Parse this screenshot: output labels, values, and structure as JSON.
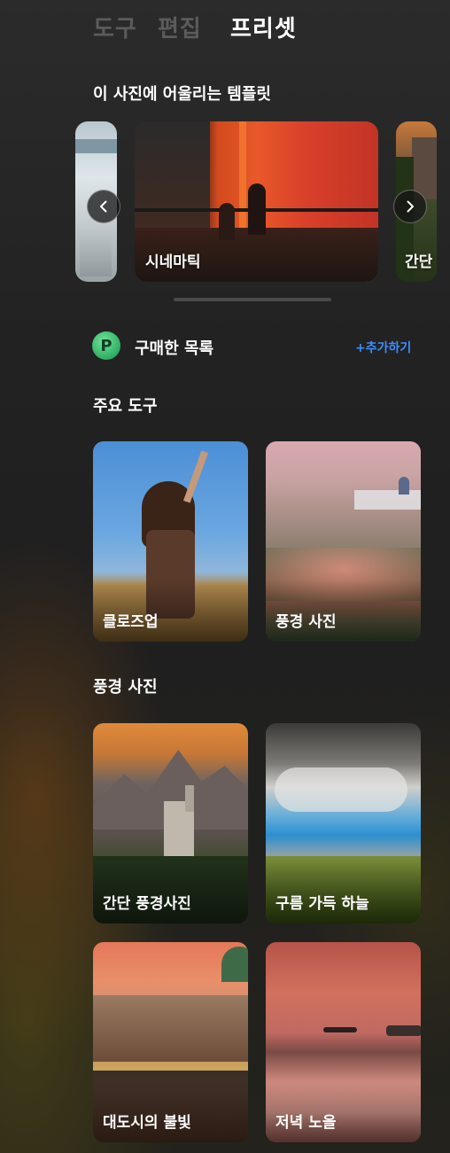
{
  "tabs": [
    {
      "label": "도구",
      "active": false
    },
    {
      "label": "편집",
      "active": false
    },
    {
      "label": "프리셋",
      "active": true
    }
  ],
  "templates_section": {
    "title": "이 사진에 어울리는 템플릿",
    "cards": [
      {
        "label": ""
      },
      {
        "label": "시네마틱"
      },
      {
        "label": "간단"
      }
    ]
  },
  "purchased": {
    "icon_letter": "P",
    "title": "구매한 목록",
    "add_label": "+추가하기"
  },
  "main_tools": {
    "title": "주요 도구",
    "items": [
      {
        "label": "클로즈업"
      },
      {
        "label": "풍경 사진"
      }
    ]
  },
  "landscape": {
    "title": "풍경 사진",
    "items": [
      {
        "label": "간단 풍경사진"
      },
      {
        "label": "구름 가득 하늘"
      },
      {
        "label": "대도시의 불빛"
      },
      {
        "label": "저녁 노을"
      }
    ]
  },
  "colors": {
    "accent": "#3d8dff",
    "tab_inactive": "#5b5b5b",
    "background": "#222222"
  }
}
